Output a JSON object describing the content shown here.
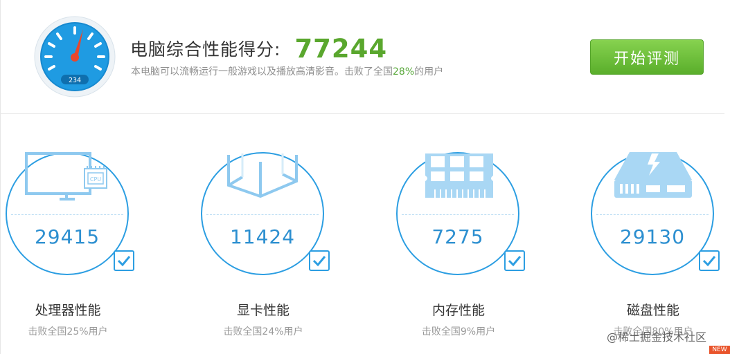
{
  "header": {
    "gauge_reading": "234",
    "title_label": "电脑综合性能得分:",
    "total_score": "77244",
    "summary_prefix": "本电脑可以流畅运行一般游戏以及播放高清影音。击败了全国",
    "summary_percent": "28%",
    "summary_suffix": "的用户",
    "start_button_label": "开始评测"
  },
  "metrics": [
    {
      "icon": "cpu-monitor-icon",
      "score": "29415",
      "label": "处理器性能",
      "beat": "击败全国25%用户"
    },
    {
      "icon": "gpu-cube-icon",
      "score": "11424",
      "label": "显卡性能",
      "beat": "击败全国24%用户"
    },
    {
      "icon": "memory-chip-icon",
      "score": "7275",
      "label": "内存性能",
      "beat": "击败全国9%用户"
    },
    {
      "icon": "disk-drive-icon",
      "score": "29130",
      "label": "磁盘性能",
      "beat": "击败全国80%用户"
    }
  ],
  "watermark": "@稀土掘金技术社区",
  "badge": "NEW",
  "colors": {
    "score_green": "#5aa72e",
    "accent_blue": "#2c9ee2",
    "button_green": "#6cc23a"
  }
}
